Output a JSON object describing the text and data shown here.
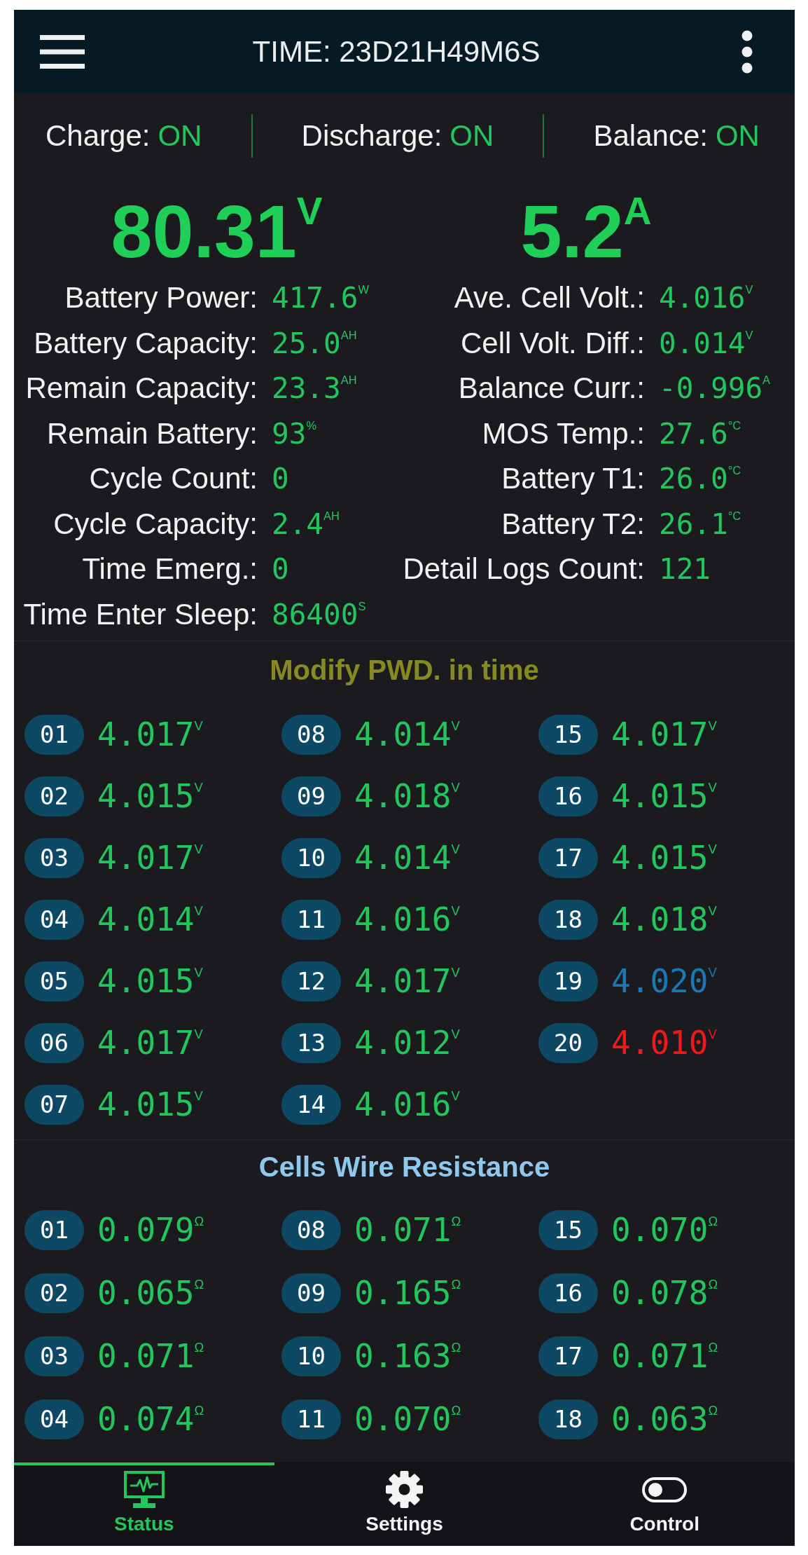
{
  "header": {
    "title": "TIME: 23D21H49M6S"
  },
  "switches": [
    {
      "label": "Charge:",
      "value": "ON"
    },
    {
      "label": "Discharge:",
      "value": "ON"
    },
    {
      "label": "Balance:",
      "value": "ON"
    }
  ],
  "readings": [
    {
      "value": "80.31$^{V}$"
    },
    {
      "value": "5.2$^{A}$"
    }
  ],
  "stats": {
    "left": [
      {
        "label": "Battery Power:",
        "value": "417.6$^{W}$"
      },
      {
        "label": "Battery Capacity:",
        "value": "25.0$^{AH}$"
      },
      {
        "label": "Remain Capacity:",
        "value": "23.3$^{AH}$"
      },
      {
        "label": "Remain Battery:",
        "value": "93$^{%}$"
      },
      {
        "label": "Cycle Count:",
        "value": "0"
      },
      {
        "label": "Cycle Capacity:",
        "value": "2.4$^{AH}$"
      },
      {
        "label": "Time Emerg.:",
        "value": "0"
      },
      {
        "label": "Time Enter Sleep:",
        "value": "86400$^{S}$"
      }
    ],
    "right": [
      {
        "label": "Ave. Cell Volt.:",
        "value": "4.016$^{V}$"
      },
      {
        "label": "Cell Volt. Diff.:",
        "value": "0.014$^{V}$"
      },
      {
        "label": "Balance Curr.:",
        "value": "-0.996$^{A}$"
      },
      {
        "label": "MOS Temp.:",
        "value": "27.6$^{°C}$"
      },
      {
        "label": "Battery T1:",
        "value": "26.0$^{°C}$"
      },
      {
        "label": "Battery T2:",
        "value": "26.1$^{°C}$"
      },
      {
        "label": "Detail Logs Count:",
        "value": "121"
      }
    ]
  },
  "cell_voltages": {
    "title": "Modify PWD. in time",
    "cells": [
      {
        "number": "01",
        "value": "4.017$^{V}$",
        "color": "#21c75d"
      },
      {
        "number": "02",
        "value": "4.015$^{V}$",
        "color": "#21c75d"
      },
      {
        "number": "03",
        "value": "4.017$^{V}$",
        "color": "#21c75d"
      },
      {
        "number": "04",
        "value": "4.014$^{V}$",
        "color": "#21c75d"
      },
      {
        "number": "05",
        "value": "4.015$^{V}$",
        "color": "#21c75d"
      },
      {
        "number": "06",
        "value": "4.017$^{V}$",
        "color": "#21c75d"
      },
      {
        "number": "07",
        "value": "4.015$^{V}$",
        "color": "#21c75d"
      },
      {
        "number": "08",
        "value": "4.014$^{V}$",
        "color": "#21c75d"
      },
      {
        "number": "09",
        "value": "4.018$^{V}$",
        "color": "#21c75d"
      },
      {
        "number": "10",
        "value": "4.014$^{V}$",
        "color": "#21c75d"
      },
      {
        "number": "11",
        "value": "4.016$^{V}$",
        "color": "#21c75d"
      },
      {
        "number": "12",
        "value": "4.017$^{V}$",
        "color": "#21c75d"
      },
      {
        "number": "13",
        "value": "4.012$^{V}$",
        "color": "#21c75d"
      },
      {
        "number": "14",
        "value": "4.016$^{V}$",
        "color": "#21c75d"
      },
      {
        "number": "15",
        "value": "4.017$^{V}$",
        "color": "#21c75d"
      },
      {
        "number": "16",
        "value": "4.015$^{V}$",
        "color": "#21c75d"
      },
      {
        "number": "17",
        "value": "4.015$^{V}$",
        "color": "#21c75d"
      },
      {
        "number": "18",
        "value": "4.018$^{V}$",
        "color": "#21c75d"
      },
      {
        "number": "19",
        "value": "4.020$^{V}$",
        "color": "#1a78b4"
      },
      {
        "number": "20",
        "value": "4.010$^{V}$",
        "color": "#f01818"
      }
    ]
  },
  "wire_resistance": {
    "title": "Cells Wire Resistance",
    "cells": [
      {
        "number": "01",
        "value": "0.079$^{Ω}$"
      },
      {
        "number": "02",
        "value": "0.065$^{Ω}$"
      },
      {
        "number": "03",
        "value": "0.071$^{Ω}$"
      },
      {
        "number": "04",
        "value": "0.074$^{Ω}$"
      },
      {
        "number": "08",
        "value": "0.071$^{Ω}$"
      },
      {
        "number": "09",
        "value": "0.165$^{Ω}$"
      },
      {
        "number": "10",
        "value": "0.163$^{Ω}$"
      },
      {
        "number": "11",
        "value": "0.070$^{Ω}$"
      },
      {
        "number": "15",
        "value": "0.070$^{Ω}$"
      },
      {
        "number": "16",
        "value": "0.078$^{Ω}$"
      },
      {
        "number": "17",
        "value": "0.071$^{Ω}$"
      },
      {
        "number": "18",
        "value": "0.063$^{Ω}$"
      }
    ]
  },
  "tabs": [
    {
      "label": "Status",
      "selected": true
    },
    {
      "label": "Settings",
      "selected": false
    },
    {
      "label": "Control",
      "selected": false
    }
  ]
}
